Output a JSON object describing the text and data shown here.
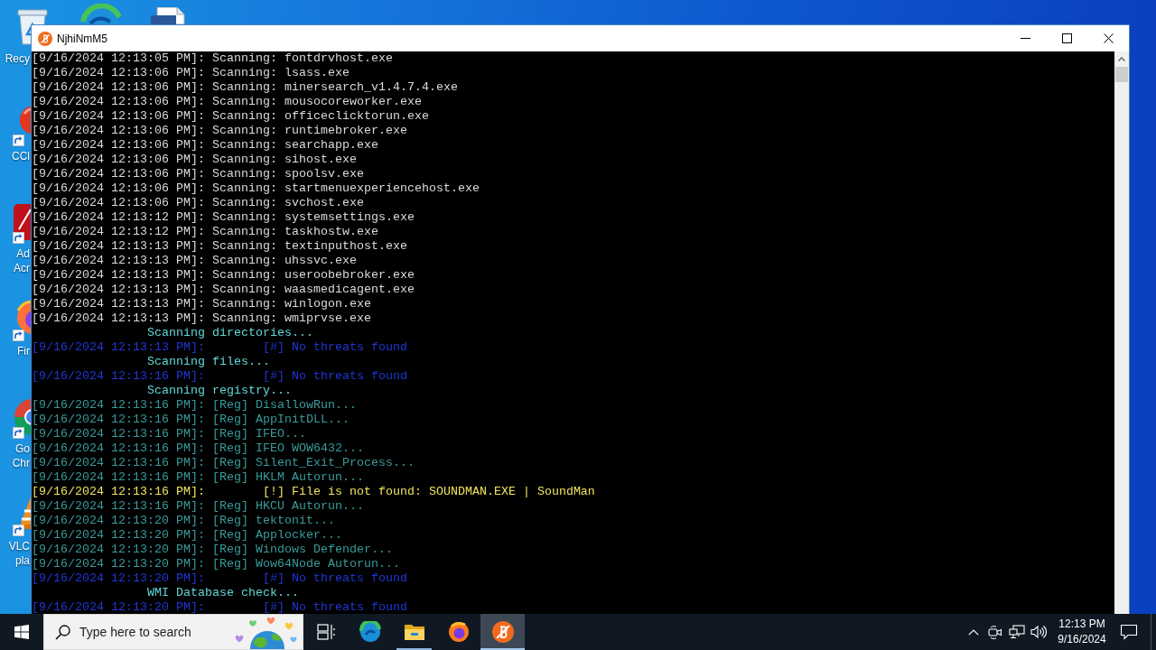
{
  "desktop": {
    "icons": [
      {
        "kind": "recycle",
        "lines": [
          "Recy"
        ]
      },
      {
        "kind": "cleaner",
        "lines": [
          "CCl"
        ]
      },
      {
        "kind": "acrobat",
        "lines": [
          "Ad",
          "Acr"
        ]
      },
      {
        "kind": "firefox",
        "lines": [
          "Fir"
        ]
      },
      {
        "kind": "chrome",
        "lines": [
          "Go",
          "Chr"
        ]
      },
      {
        "kind": "vlc",
        "lines": [
          "VLC",
          "pla"
        ]
      }
    ]
  },
  "window": {
    "title": "NjhiNmM5",
    "lines": [
      {
        "kind": "scan",
        "time": "[9/16/2024 12:13:05 PM]:",
        "text": "Scanning: fontdrvhost.exe"
      },
      {
        "kind": "scan",
        "time": "[9/16/2024 12:13:06 PM]:",
        "text": "Scanning: lsass.exe"
      },
      {
        "kind": "scan",
        "time": "[9/16/2024 12:13:06 PM]:",
        "text": "Scanning: minersearch_v1.4.7.4.exe"
      },
      {
        "kind": "scan",
        "time": "[9/16/2024 12:13:06 PM]:",
        "text": "Scanning: mousocoreworker.exe"
      },
      {
        "kind": "scan",
        "time": "[9/16/2024 12:13:06 PM]:",
        "text": "Scanning: officeclicktorun.exe"
      },
      {
        "kind": "scan",
        "time": "[9/16/2024 12:13:06 PM]:",
        "text": "Scanning: runtimebroker.exe"
      },
      {
        "kind": "scan",
        "time": "[9/16/2024 12:13:06 PM]:",
        "text": "Scanning: searchapp.exe"
      },
      {
        "kind": "scan",
        "time": "[9/16/2024 12:13:06 PM]:",
        "text": "Scanning: sihost.exe"
      },
      {
        "kind": "scan",
        "time": "[9/16/2024 12:13:06 PM]:",
        "text": "Scanning: spoolsv.exe"
      },
      {
        "kind": "scan",
        "time": "[9/16/2024 12:13:06 PM]:",
        "text": "Scanning: startmenuexperiencehost.exe"
      },
      {
        "kind": "scan",
        "time": "[9/16/2024 12:13:06 PM]:",
        "text": "Scanning: svchost.exe"
      },
      {
        "kind": "scan",
        "time": "[9/16/2024 12:13:12 PM]:",
        "text": "Scanning: systemsettings.exe"
      },
      {
        "kind": "scan",
        "time": "[9/16/2024 12:13:12 PM]:",
        "text": "Scanning: taskhostw.exe"
      },
      {
        "kind": "scan",
        "time": "[9/16/2024 12:13:13 PM]:",
        "text": "Scanning: textinputhost.exe"
      },
      {
        "kind": "scan",
        "time": "[9/16/2024 12:13:13 PM]:",
        "text": "Scanning: uhssvc.exe"
      },
      {
        "kind": "scan",
        "time": "[9/16/2024 12:13:13 PM]:",
        "text": "Scanning: useroobebroker.exe"
      },
      {
        "kind": "scan",
        "time": "[9/16/2024 12:13:13 PM]:",
        "text": "Scanning: waasmedicagent.exe"
      },
      {
        "kind": "scan",
        "time": "[9/16/2024 12:13:13 PM]:",
        "text": "Scanning: winlogon.exe"
      },
      {
        "kind": "scan",
        "time": "[9/16/2024 12:13:13 PM]:",
        "text": "Scanning: wmiprvse.exe"
      },
      {
        "kind": "header",
        "text": "Scanning directories..."
      },
      {
        "kind": "result",
        "time": "[9/16/2024 12:13:13 PM]:",
        "text": "[#] No threats found"
      },
      {
        "kind": "header",
        "text": "Scanning files..."
      },
      {
        "kind": "result",
        "time": "[9/16/2024 12:13:16 PM]:",
        "text": "[#] No threats found"
      },
      {
        "kind": "header",
        "text": "Scanning registry..."
      },
      {
        "kind": "reg",
        "time": "[9/16/2024 12:13:16 PM]:",
        "text": "[Reg] DisallowRun..."
      },
      {
        "kind": "reg",
        "time": "[9/16/2024 12:13:16 PM]:",
        "text": "[Reg] AppInitDLL..."
      },
      {
        "kind": "reg",
        "time": "[9/16/2024 12:13:16 PM]:",
        "text": "[Reg] IFEO..."
      },
      {
        "kind": "reg",
        "time": "[9/16/2024 12:13:16 PM]:",
        "text": "[Reg] IFEO WOW6432..."
      },
      {
        "kind": "reg",
        "time": "[9/16/2024 12:13:16 PM]:",
        "text": "[Reg] Silent_Exit_Process..."
      },
      {
        "kind": "reg",
        "time": "[9/16/2024 12:13:16 PM]:",
        "text": "[Reg] HKLM Autorun..."
      },
      {
        "kind": "warning",
        "time": "[9/16/2024 12:13:16 PM]:",
        "text": "[!] File is not found: SOUNDMAN.EXE | SoundMan"
      },
      {
        "kind": "reg",
        "time": "[9/16/2024 12:13:16 PM]:",
        "text": "[Reg] HKCU Autorun..."
      },
      {
        "kind": "reg",
        "time": "[9/16/2024 12:13:20 PM]:",
        "text": "[Reg] tektonit..."
      },
      {
        "kind": "reg",
        "time": "[9/16/2024 12:13:20 PM]:",
        "text": "[Reg] Applocker..."
      },
      {
        "kind": "reg",
        "time": "[9/16/2024 12:13:20 PM]:",
        "text": "[Reg] Windows Defender..."
      },
      {
        "kind": "reg",
        "time": "[9/16/2024 12:13:20 PM]:",
        "text": "[Reg] Wow64Node Autorun..."
      },
      {
        "kind": "result",
        "time": "[9/16/2024 12:13:20 PM]:",
        "text": "[#] No threats found"
      },
      {
        "kind": "header",
        "text": "WMI Database check..."
      },
      {
        "kind": "result",
        "time": "[9/16/2024 12:13:20 PM]:",
        "text": "[#] No threats found"
      }
    ]
  },
  "taskbar": {
    "search": {
      "placeholder": "Type here to search"
    },
    "apps": [
      {
        "kind": "edge",
        "open": false,
        "selected": false
      },
      {
        "kind": "explorer",
        "open": true,
        "selected": false
      },
      {
        "kind": "firefox",
        "open": false,
        "selected": false
      },
      {
        "kind": "scanner",
        "open": true,
        "selected": true
      }
    ],
    "clock": {
      "time": "12:13 PM",
      "date": "9/16/2024"
    }
  }
}
